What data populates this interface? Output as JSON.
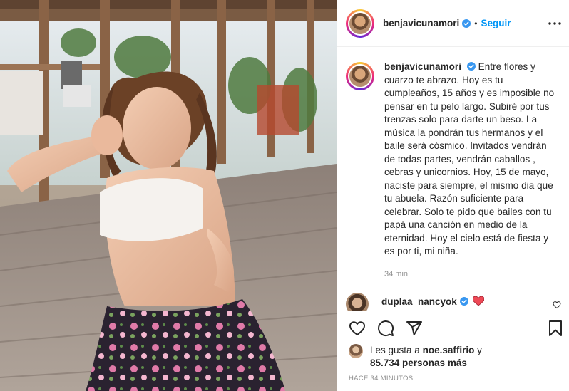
{
  "post": {
    "photo_description_icon": "photo-image",
    "author": "benjavicunamori",
    "follow_label": "Seguir",
    "separator": "•",
    "more_icon": "more-options-icon"
  },
  "caption": {
    "author": "benjavicunamori",
    "text": "Entre flores y cuarzo te abrazo. Hoy es tu cumpleaños, 15 años y es imposible no pensar en tu pelo largo. Subiré por tus trenzas solo para darte un beso. La música la pondrán tus hermanos y el baile será cósmico. Invitados vendrán de todas partes, vendrán caballos , cebras y unicornios. Hoy, 15 de mayo, naciste para siempre, el mismo dia que tu abuela. Razón suficiente para celebrar. Solo te pido que bailes con tu papá una canción en medio de la eternidad. Hoy el cielo está de fiesta y es por ti, mi niña.",
    "timestamp": "34 min"
  },
  "comment": {
    "author": "duplaa_nancyok"
  },
  "actions": {
    "icons": [
      "heart-icon",
      "comment-icon",
      "share-icon",
      "bookmark-icon"
    ]
  },
  "likes": {
    "prefix": "Les gusta a",
    "user": "noe.saffirio",
    "conjunction": "y",
    "count": "85.734 personas más"
  },
  "time_ago": "HACE 34 MINUTOS",
  "colors": {
    "link_blue": "#0095f6",
    "verified_blue": "#3897f0",
    "muted": "#8e8e8e",
    "heart_red": "#ed4956"
  }
}
